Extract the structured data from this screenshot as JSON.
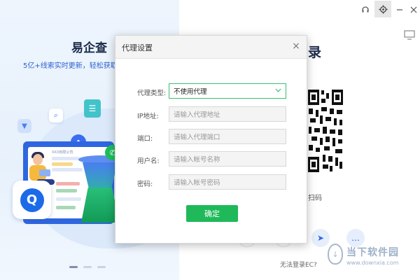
{
  "promo": {
    "app_name": "易企查",
    "tagline": "5亿+线索实时更新，轻松获取",
    "screen_label": "XXX有限公司"
  },
  "login": {
    "title": "录",
    "scan_text": "扫码",
    "cannot_login": "无法登录EC?"
  },
  "watermark": {
    "name": "当下软件园",
    "url": "www.downxia.com",
    "logo_glyph": "↓"
  },
  "proxy_dialog": {
    "title": "代理设置",
    "close_glyph": "×",
    "fields": {
      "type": {
        "label": "代理类型:",
        "value": "不使用代理"
      },
      "ip": {
        "label": "IP地址:",
        "placeholder": "请输入代理地址"
      },
      "port": {
        "label": "端口:",
        "placeholder": "请输入代理端口"
      },
      "username": {
        "label": "用户名:",
        "placeholder": "请输入帐号名称"
      },
      "password": {
        "label": "密码:",
        "placeholder": "请输入帐号密码"
      }
    },
    "confirm_label": "确定"
  },
  "icons": {
    "headset": "headset-icon",
    "settings": "gear-icon",
    "minimize": "minimize-icon",
    "close": "close-icon",
    "monitor": "monitor-icon"
  },
  "colors": {
    "accent_green": "#1fb95a",
    "brand_blue": "#1b6be8",
    "select_border": "#3bbf72"
  }
}
